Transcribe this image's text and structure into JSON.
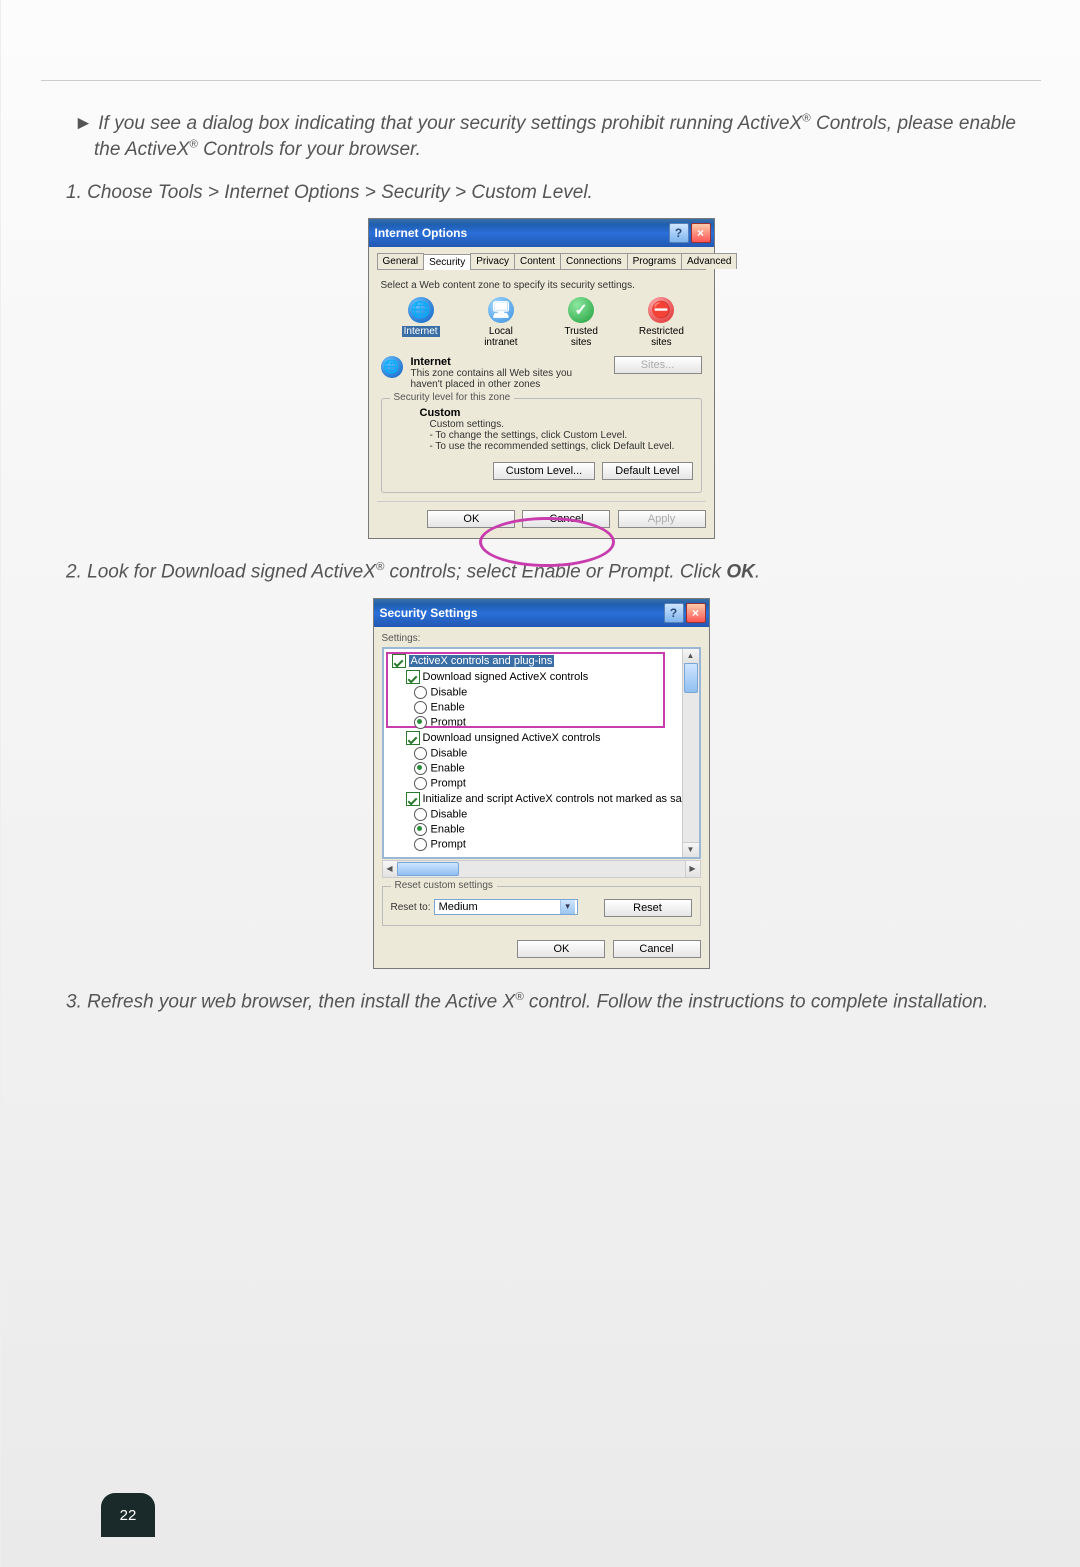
{
  "note_arrow": "►",
  "note_text_1": "If you see a dialog box indicating that your security settings prohibit running ActiveX",
  "note_text_2": "Controls, please enable the ActiveX",
  "note_text_3": " Controls for your browser.",
  "step1": "1. Choose Tools > Internet Options > Security > Custom Level.",
  "step2_a": "2. Look for Download signed ActiveX",
  "step2_b": " controls; select Enable or Prompt. Click ",
  "step2_ok": "OK",
  "step2_c": ".",
  "step3_a": "3. Refresh your web browser, then install the Active X",
  "step3_b": " control. Follow the instructions to complete installation.",
  "page_number": "22",
  "dlg1": {
    "title": "Internet Options",
    "tabs": [
      "General",
      "Security",
      "Privacy",
      "Content",
      "Connections",
      "Programs",
      "Advanced"
    ],
    "active_tab": 1,
    "instruction": "Select a Web content zone to specify its security settings.",
    "zones": [
      {
        "label": "Internet",
        "selected": true
      },
      {
        "label": "Local intranet"
      },
      {
        "label": "Trusted sites"
      },
      {
        "label": "Restricted sites"
      }
    ],
    "zone_info_title": "Internet",
    "zone_info_text1": "This zone contains all Web sites you",
    "zone_info_text2": "haven't placed in other zones",
    "sites_btn": "Sites...",
    "group_legend": "Security level for this zone",
    "custom_title": "Custom",
    "custom_sub": "Custom settings.",
    "custom_l1": "- To change the settings, click Custom Level.",
    "custom_l2": "- To use the recommended settings, click Default Level.",
    "custom_level_btn": "Custom Level...",
    "default_level_btn": "Default Level",
    "ok": "OK",
    "cancel": "Cancel",
    "apply": "Apply"
  },
  "dlg2": {
    "title": "Security Settings",
    "settings_label": "Settings:",
    "cat1": "ActiveX controls and plug-ins",
    "item1": "Download signed ActiveX controls",
    "item2": "Download unsigned ActiveX controls",
    "item3": "Initialize and script ActiveX controls not marked as safe",
    "opt_disable": "Disable",
    "opt_enable": "Enable",
    "opt_prompt": "Prompt",
    "reset_legend": "Reset custom settings",
    "reset_to": "Reset to:",
    "reset_value": "Medium",
    "reset_btn": "Reset",
    "ok": "OK",
    "cancel": "Cancel"
  }
}
